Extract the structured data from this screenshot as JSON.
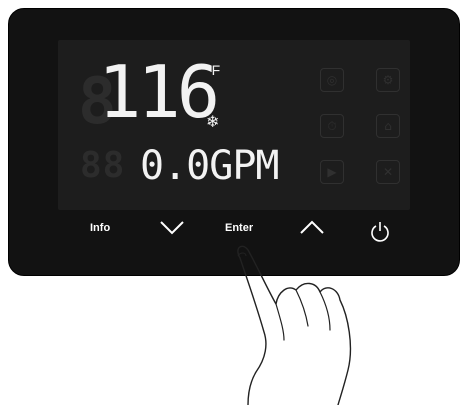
{
  "display": {
    "temperature": "116",
    "temperature_unit": "°F",
    "snowflake_icon": "snowflake-icon",
    "flow_value": "0.0",
    "flow_unit": "GPM"
  },
  "buttons": {
    "info": "Info",
    "enter": "Enter",
    "down_icon": "chevron-down-icon",
    "up_icon": "chevron-up-icon",
    "power_icon": "power-icon"
  }
}
